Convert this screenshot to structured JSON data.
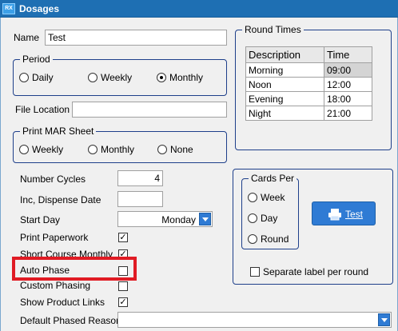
{
  "window": {
    "title": "Dosages",
    "icon": "app-icon"
  },
  "name_field": {
    "label": "Name",
    "value": "Test"
  },
  "period": {
    "legend": "Period",
    "options": [
      {
        "label": "Daily",
        "selected": false
      },
      {
        "label": "Weekly",
        "selected": false
      },
      {
        "label": "Monthly",
        "selected": true
      }
    ]
  },
  "file_location": {
    "label": "File Location",
    "value": ""
  },
  "print_mar": {
    "legend": "Print MAR Sheet",
    "options": [
      {
        "label": "Weekly",
        "selected": false
      },
      {
        "label": "Monthly",
        "selected": false
      },
      {
        "label": "None",
        "selected": false
      }
    ]
  },
  "fields": {
    "number_cycles": {
      "label": "Number Cycles",
      "value": "4"
    },
    "inc_dispense": {
      "label": "Inc, Dispense Date",
      "value": ""
    },
    "start_day": {
      "label": "Start Day",
      "value": "Monday"
    },
    "print_paperwork": {
      "label": "Print Paperwork",
      "checked": true
    },
    "short_course": {
      "label": "Short Course Monthly",
      "checked": true
    },
    "auto_phase": {
      "label": "Auto Phase",
      "checked": false
    },
    "custom_phasing": {
      "label": "Custom Phasing",
      "checked": false
    },
    "show_product_links": {
      "label": "Show Product Links",
      "checked": true
    },
    "default_phased_reason": {
      "label": "Default Phased Reason",
      "value": ""
    }
  },
  "round_times": {
    "legend": "Round Times",
    "headers": [
      "Description",
      "Time"
    ],
    "rows": [
      [
        "Morning",
        "09:00"
      ],
      [
        "Noon",
        "12:00"
      ],
      [
        "Evening",
        "18:00"
      ],
      [
        "Night",
        "21:00"
      ]
    ]
  },
  "cards_per": {
    "legend": "Cards Per",
    "options": [
      {
        "label": "Week",
        "selected": false
      },
      {
        "label": "Day",
        "selected": false
      },
      {
        "label": "Round",
        "selected": false
      }
    ]
  },
  "test_button": {
    "label": "Test",
    "icon": "printer-icon"
  },
  "separate_label": {
    "label": "Separate label per round",
    "checked": false
  },
  "colors": {
    "titlebar": "#1e6fb3",
    "accent": "#2f7bd4",
    "highlight": "#e01b24",
    "group_border": "#1e3f8a"
  }
}
